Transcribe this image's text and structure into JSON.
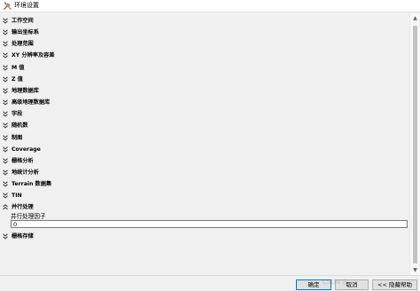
{
  "window": {
    "title": "环境设置",
    "icon": "tools-icon"
  },
  "sections": [
    {
      "label": "工作空间",
      "expanded": false
    },
    {
      "label": "输出坐标系",
      "expanded": false
    },
    {
      "label": "处理范围",
      "expanded": false
    },
    {
      "label": "XY 分辨率及容差",
      "expanded": false
    },
    {
      "label": "M 值",
      "expanded": false
    },
    {
      "label": "Z 值",
      "expanded": false
    },
    {
      "label": "地理数据库",
      "expanded": false
    },
    {
      "label": "高级地理数据库",
      "expanded": false
    },
    {
      "label": "字段",
      "expanded": false
    },
    {
      "label": "随机数",
      "expanded": false
    },
    {
      "label": "制图",
      "expanded": false
    },
    {
      "label": "Coverage",
      "expanded": false
    },
    {
      "label": "栅格分析",
      "expanded": false
    },
    {
      "label": "地统计分析",
      "expanded": false
    },
    {
      "label": "Terrain 数据集",
      "expanded": false
    },
    {
      "label": "TIN",
      "expanded": false
    },
    {
      "label": "并行处理",
      "expanded": true
    },
    {
      "label": "栅格存储",
      "expanded": false
    }
  ],
  "parallel": {
    "field_label": "并行处理因子",
    "value": "0"
  },
  "buttons": {
    "ok": "确定",
    "cancel": "取消",
    "help": "<< 隐藏帮助"
  },
  "watermark": "CSDN @"
}
